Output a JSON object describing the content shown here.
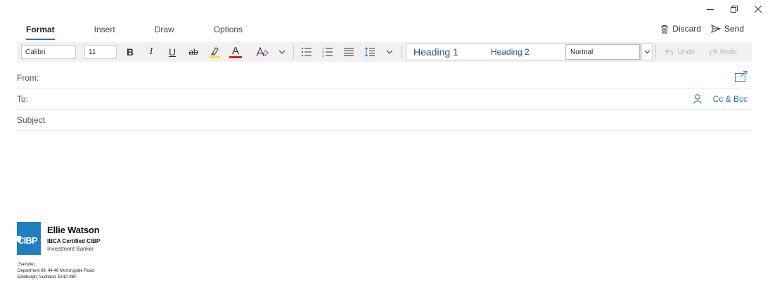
{
  "window": {
    "controls": [
      "minimize-icon",
      "restore-icon",
      "close-icon"
    ]
  },
  "tabs": [
    {
      "label": "Format",
      "active": true
    },
    {
      "label": "Insert",
      "active": false
    },
    {
      "label": "Draw",
      "active": false
    },
    {
      "label": "Options",
      "active": false
    }
  ],
  "actions": {
    "discard_label": "Discard",
    "send_label": "Send"
  },
  "toolbar": {
    "font_name": "Calibri",
    "font_size": "11",
    "bold": "B",
    "italic": "I",
    "underline": "U",
    "strikethrough": "ab",
    "font_color_letter": "A",
    "highlight_color": "#f3e43a",
    "font_color": "#e01e1e",
    "heading1": "Heading 1",
    "heading2": "Heading 2",
    "style_value": "Normal",
    "undo_label": "Undo",
    "redo_label": "Redo"
  },
  "fields": {
    "from_label": "From:",
    "to_label": "To:",
    "subject_placeholder": "Subject",
    "cc_bcc_label": "Cc & Bcc"
  },
  "signature": {
    "logo_text": "CIBP",
    "logo_color": "#1e7fc1",
    "name": "Ellie Watson",
    "certification": "IBCA Certified CIBP",
    "title": "Investment Banker",
    "address_lines": [
      "(Sample)",
      "Department 98, 44-46 Morningside Road",
      "Edinburgh, Scotland, Eh10 4BF"
    ]
  },
  "colors": {
    "accent": "#2b73b8"
  }
}
